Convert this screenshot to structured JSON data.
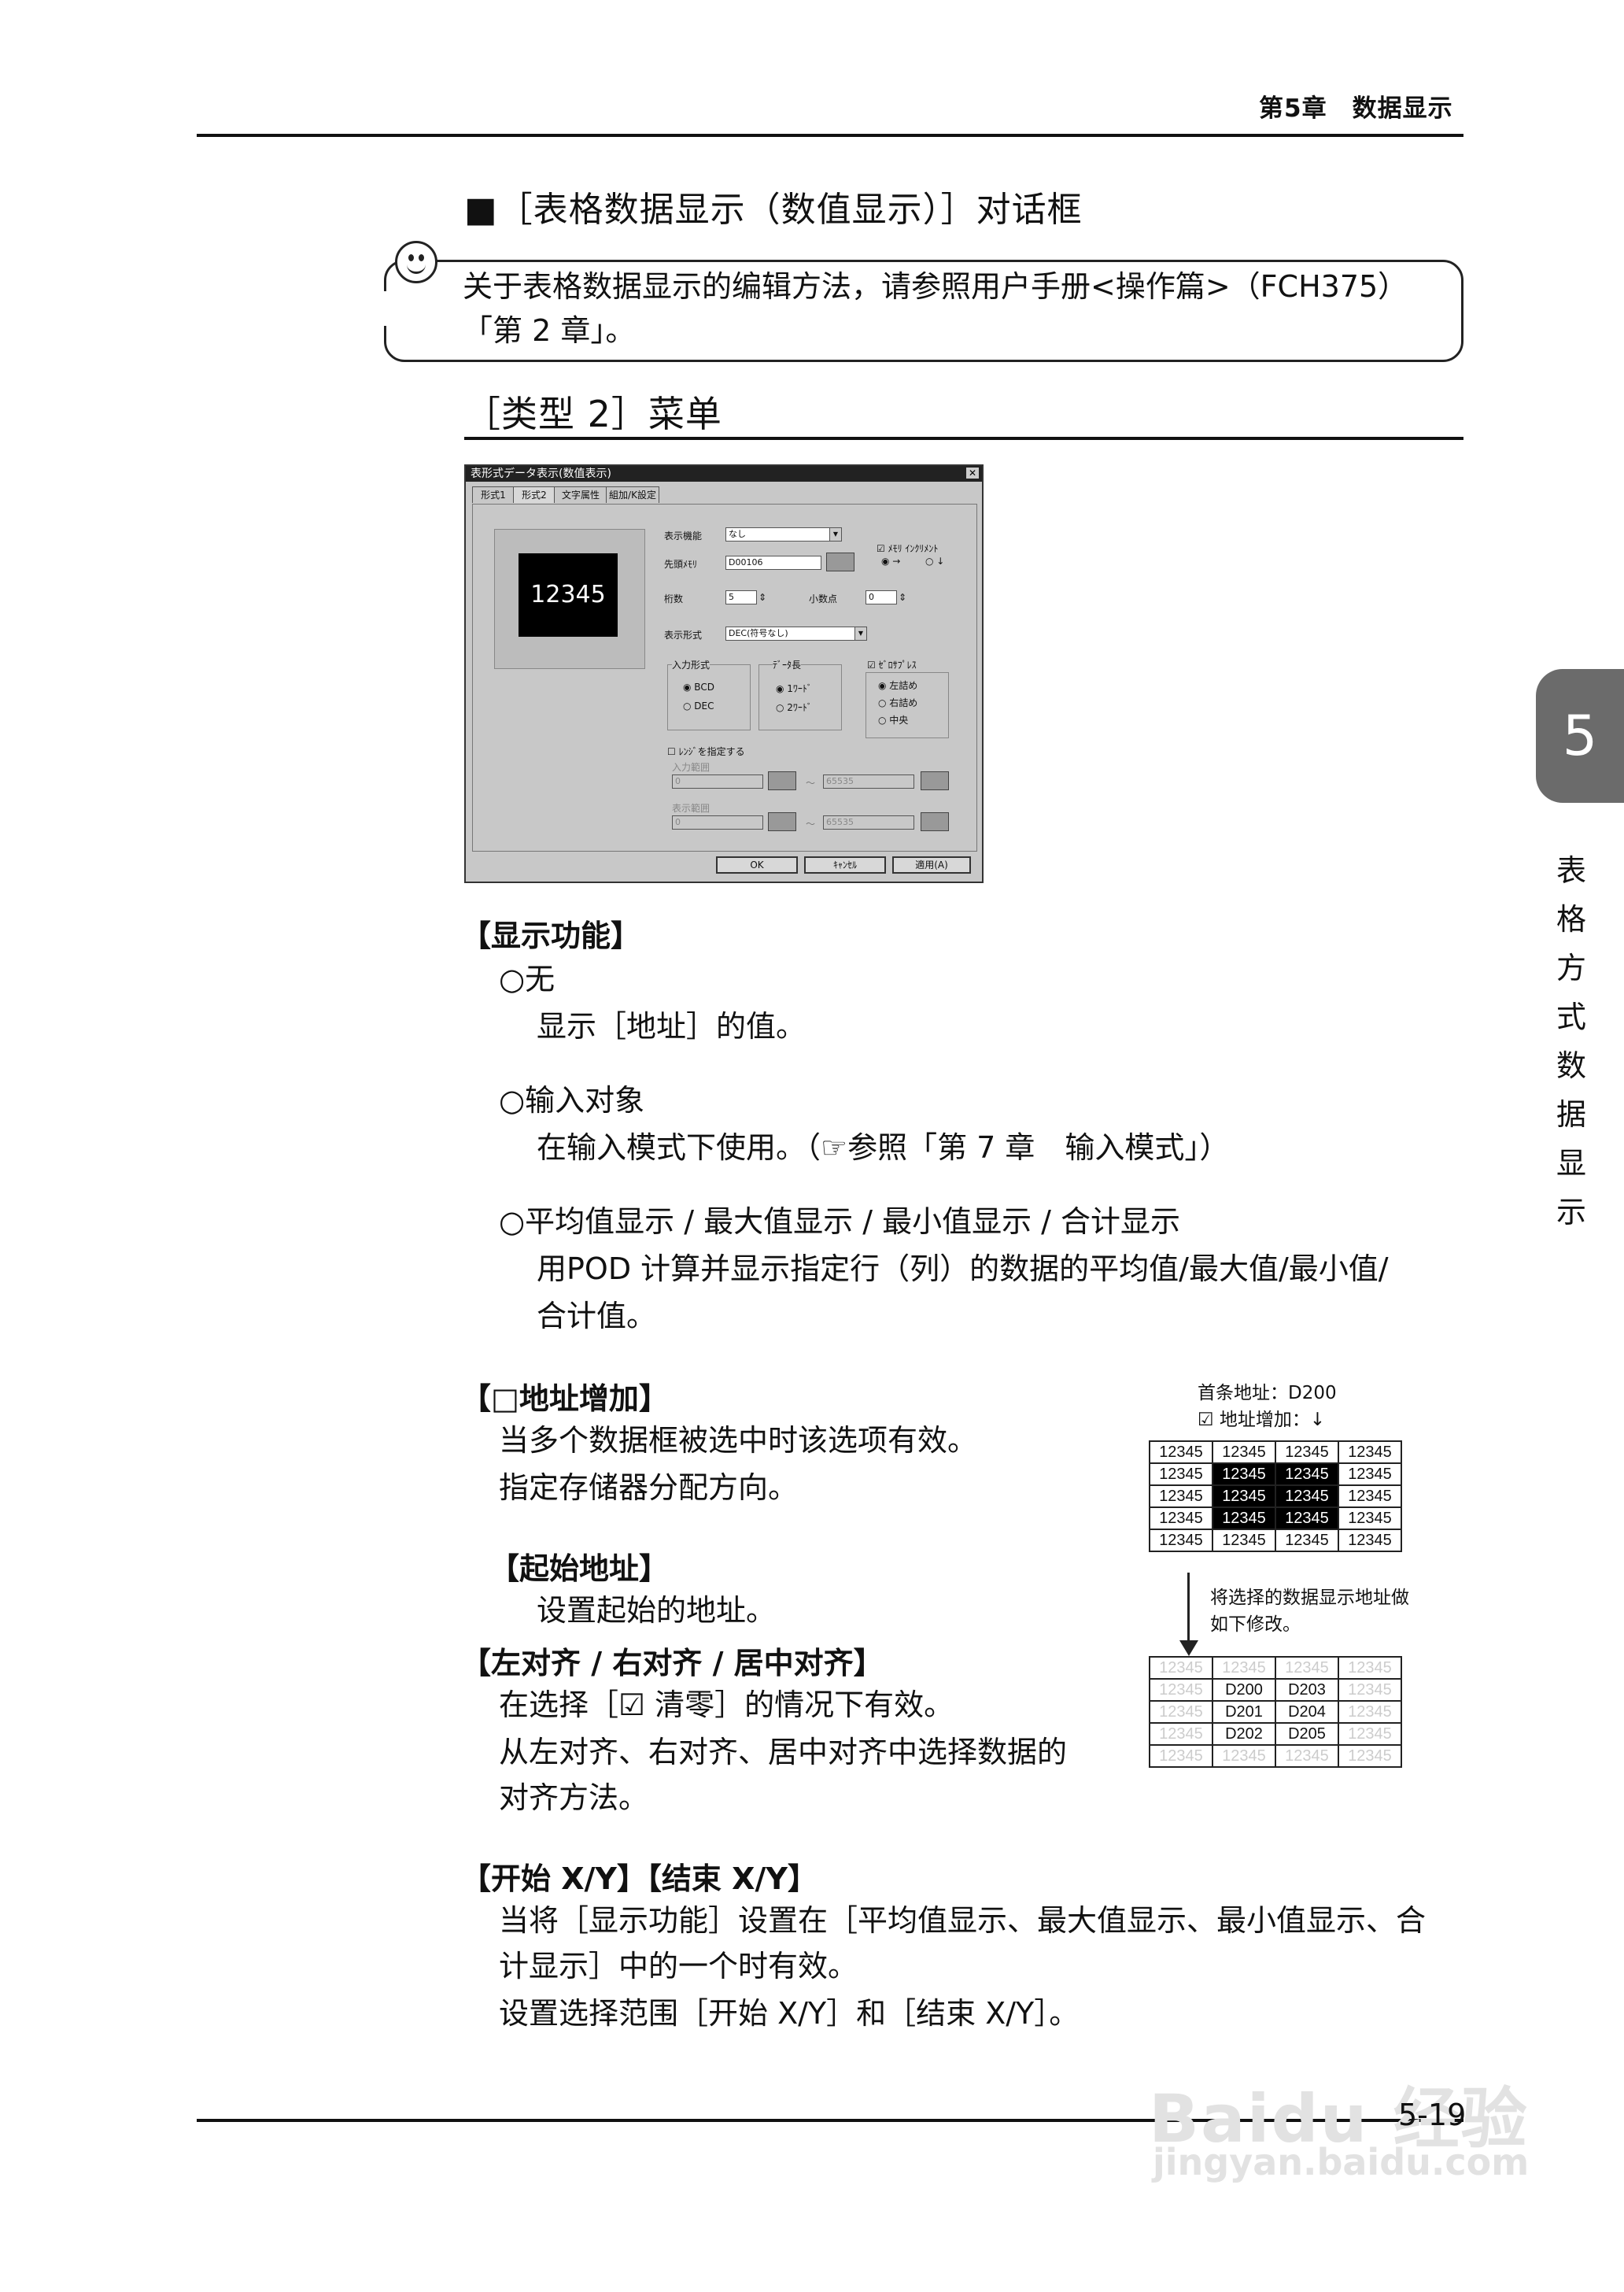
{
  "header": {
    "chapter": "第5章　数据显示"
  },
  "section": {
    "title": "■［表格数据显示（数值显示）］对话框",
    "note_line1": "关于表格数据显示的编辑方法，请参照用户手册<操作篇>（FCH375）",
    "note_line2": "「第 2 章」。",
    "subtitle": "［类型 2］菜单"
  },
  "dialog": {
    "title": "表形式データ表示(数值表示)",
    "tabs": [
      "形式1",
      "形式2",
      "文字属性",
      "組加/K設定"
    ],
    "preview_value": "12345",
    "labels": {
      "display_func": "表示機能",
      "start_mem": "先頭ﾒﾓﾘ",
      "digits": "桁数",
      "decimal": "小数点",
      "display_fmt": "表示形式",
      "input_fmt": "入力形式",
      "data_len": "ﾃﾞｰﾀ長",
      "memory_inc": "ﾒﾓﾘ ｲﾝｸﾘﾒﾝﾄ",
      "zero_suppress": "ｾﾞﾛｻﾌﾟﾚｽ",
      "range_spec": "ﾚﾝｼﾞを指定する",
      "input_range": "入力範囲",
      "display_range": "表示範囲"
    },
    "values": {
      "display_func": "なし",
      "start_mem": "D00106",
      "digits": "5",
      "decimal": "0",
      "display_fmt": "DEC(符号なし)",
      "range_min": "0",
      "range_max": "65535",
      "range_sep": "～"
    },
    "radios": {
      "arrow_right": "→",
      "arrow_down": "↓",
      "bcd": "BCD",
      "dec": "DEC",
      "word1": "1ﾜｰﾄﾞ",
      "word2": "2ﾜｰﾄﾞ",
      "left": "左詰め",
      "right": "右詰め",
      "center": "中央"
    },
    "buttons": {
      "ok": "OK",
      "cancel": "ｷｬﾝｾﾙ",
      "apply": "適用(A)"
    }
  },
  "body": {
    "h_display": "【显示功能】",
    "opt_none": "○无",
    "opt_none_desc": "显示［地址］的值。",
    "opt_input": "○输入对象",
    "opt_input_desc": "在输入模式下使用。（☞参照「第 7 章　输入模式」）",
    "opt_calc": "○平均值显示 / 最大值显示 / 最小值显示 / 合计显示",
    "opt_calc_desc1": "用POD 计算并显示指定行（列）的数据的平均值/最大值/最小值/",
    "opt_calc_desc2": "合计值。",
    "h_addr_inc": "【□地址增加】",
    "addr_inc_1": "当多个数据框被选中时该选项有效。",
    "addr_inc_2": "指定存储器分配方向。",
    "h_start_addr": "【起始地址】",
    "start_addr_desc": "设置起始的地址。",
    "h_align": "【左对齐 / 右对齐 / 居中对齐】",
    "align_1": "在选择［☑ 清零］的情况下有效。",
    "align_2": "从左对齐、右对齐、居中对齐中选择数据的",
    "align_3": "对齐方法。",
    "h_xy": "【开始 X/Y】【结束 X/Y】",
    "xy_1": "当将［显示功能］设置在［平均值显示、最大值显示、最小值显示、合",
    "xy_2": "计显示］中的一个时有效。",
    "xy_3": "设置选择范围［开始 X/Y］和［结束 X/Y］。"
  },
  "figure": {
    "cap1": "首条地址：D200",
    "cap2": "☑ 地址增加：↓",
    "grid_value": "12345",
    "note1": "将选择的数据显示地址做",
    "note2": "如下修改。",
    "addresses": [
      [
        "D200",
        "D203"
      ],
      [
        "D201",
        "D204"
      ],
      [
        "D202",
        "D205"
      ]
    ]
  },
  "side_tab": {
    "number": "5",
    "text": "表格方式数据显示"
  },
  "footer": {
    "page": "5-19"
  },
  "watermark": {
    "brand": "Baidu 经验",
    "url": "jingyan.baidu.com"
  }
}
